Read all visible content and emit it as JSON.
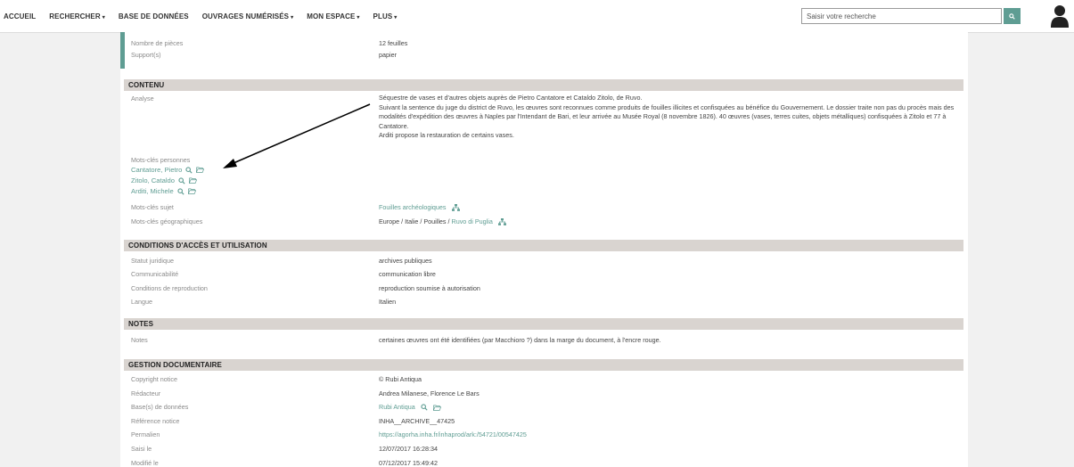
{
  "nav": {
    "items": [
      {
        "label": "ACCUEIL",
        "caret": ""
      },
      {
        "label": "RECHERCHER",
        "caret": "▾"
      },
      {
        "label": "BASE DE DONNÉES",
        "caret": ""
      },
      {
        "label": "OUVRAGES NUMÉRISÉS",
        "caret": "▾"
      },
      {
        "label": "MON ESPACE",
        "caret": "▾"
      },
      {
        "label": "PLUS",
        "caret": "▾"
      }
    ],
    "search_placeholder": "Saisir votre recherche"
  },
  "description": {
    "rows": [
      {
        "label": "Nombre de pièces",
        "value": "12 feuilles"
      },
      {
        "label": "Support(s)",
        "value": "papier"
      }
    ]
  },
  "contenu": {
    "heading": "CONTENU",
    "analyse_label": "Analyse",
    "analyse_lines": [
      "Séquestre de vases et d'autres objets auprès de Pietro Cantatore et Cataldo Zitolo, de Ruvo.",
      "Suivant la sentence du juge du district de Ruvo, les œuvres sont reconnues comme produits de fouilles illicites et confisquées au bénéfice du Gouvernement. Le dossier traite non pas du procès mais des modalités d'expédition des œuvres à Naples par l'Intendant de Bari, et leur arrivée au Musée Royal (8 novembre 1826). 40 œuvres (vases, terres cuites, objets métalliques) confisquées à Zitolo et 77 à Cantatore.",
      "Arditi propose la restauration de certains vases."
    ],
    "persons_label": "Mots-clés personnes",
    "persons": [
      "Cantatore, Pietro",
      "Zitolo, Cataldo",
      "Arditi, Michele"
    ],
    "subject_label": "Mots-clés sujet",
    "subject_value": "Fouilles archéologiques",
    "geo_label": "Mots-clés géographiques",
    "geo_value": "Europe / Italie / Pouilles / ",
    "geo_link": "Ruvo di Puglia"
  },
  "conditions": {
    "heading": "CONDITIONS D'ACCÈS ET UTILISATION",
    "rows": [
      {
        "label": "Statut juridique",
        "value": "archives publiques"
      },
      {
        "label": "Communicabilité",
        "value": "communication libre"
      },
      {
        "label": "Conditions de reproduction",
        "value": "reproduction soumise à autorisation"
      },
      {
        "label": "Langue",
        "value": "Italien"
      }
    ]
  },
  "notes": {
    "heading": "NOTES",
    "label": "Notes",
    "value": "certaines œuvres ont été identifiées (par Macchioro ?) dans la marge du document, à l'encre rouge."
  },
  "gestion": {
    "heading": "GESTION DOCUMENTAIRE",
    "rows": [
      {
        "label": "Copyright notice",
        "value": "© Rubi Antiqua"
      },
      {
        "label": "Rédacteur",
        "value": "Andrea Milanese, Florence Le Bars"
      },
      {
        "label": "Base(s) de données",
        "value": "Rubi Antiqua"
      },
      {
        "label": "Référence notice",
        "value": "INHA__ARCHIVE__47425"
      },
      {
        "label": "Permalien",
        "value": "https://agorha.inha.fr/inhaprod/ark:/54721/00547425"
      },
      {
        "label": "Saisi le",
        "value": "12/07/2017 16:28:34"
      },
      {
        "label": "Modifié le",
        "value": "07/12/2017 15:49:42"
      }
    ]
  },
  "colors": {
    "accent": "#5f9d93",
    "section_bg": "#d9d4d0",
    "page_bg": "#f1f1f1"
  }
}
